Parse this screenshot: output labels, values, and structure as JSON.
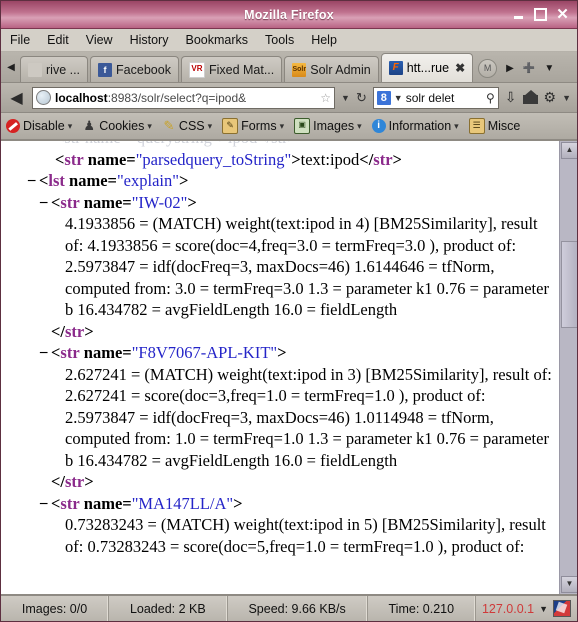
{
  "window": {
    "title": "Mozilla Firefox",
    "buttons": {
      "minimize": "_",
      "maximize": "□",
      "close": "✕"
    }
  },
  "menubar": [
    {
      "label": "File"
    },
    {
      "label": "Edit"
    },
    {
      "label": "View"
    },
    {
      "label": "History"
    },
    {
      "label": "Bookmarks"
    },
    {
      "label": "Tools"
    },
    {
      "label": "Help"
    }
  ],
  "tabbar": {
    "scroll_left": "◀",
    "scroll_right": "▶",
    "new_tab": "➕",
    "list_all": "▼",
    "tabs": [
      {
        "label": "rive ...",
        "favicon": "none-icon",
        "favicon_text": ""
      },
      {
        "label": "Facebook",
        "favicon": "facebook-icon",
        "favicon_text": "f"
      },
      {
        "label": "Fixed Mat...",
        "favicon": "vr-icon",
        "favicon_text": "VR"
      },
      {
        "label": "Solr Admin",
        "favicon": "solr-icon",
        "favicon_text": "Solr"
      },
      {
        "label": "htt...rue",
        "favicon": "firefox-icon",
        "favicon_text": "F",
        "active": true,
        "close": "✖"
      }
    ],
    "mail_button": "M"
  },
  "navbar": {
    "back_icon": "◀",
    "url_host": "localhost",
    "url_rest": ":8983/solr/select?q=ipod&",
    "star_icon": "☆",
    "dropdown_icon": "▼",
    "reload_icon": "↺",
    "search_engine": "8",
    "search_value": "solr delet",
    "search_icon": "⚲",
    "download_icon": "⇩",
    "home_icon": "home-icon",
    "extra_icon": "▼"
  },
  "devbar": [
    {
      "label": "Disable",
      "icon": "disable-icon",
      "caret": "▾"
    },
    {
      "label": "Cookies",
      "icon": "cookies-icon",
      "caret": "▾"
    },
    {
      "label": "CSS",
      "icon": "css-icon",
      "caret": "▾"
    },
    {
      "label": "Forms",
      "icon": "forms-icon",
      "caret": "▾"
    },
    {
      "label": "Images",
      "icon": "images-icon",
      "caret": "▾"
    },
    {
      "label": "Information",
      "icon": "information-icon",
      "caret": "▾"
    },
    {
      "label": "Misce",
      "icon": "misc-icon",
      "caret": ""
    }
  ],
  "content": {
    "ghost_line": "<str name=\"querystring\">ipod</str>",
    "lines": [
      {
        "indent": 1,
        "twisty": "",
        "parts": [
          {
            "t": "angle",
            "v": "<"
          },
          {
            "t": "tag",
            "v": "str"
          },
          {
            "t": "sp",
            "v": " "
          },
          {
            "t": "attr",
            "v": "name"
          },
          {
            "t": "angle",
            "v": "="
          },
          {
            "t": "attrval",
            "v": "\"parsedquery_toString\""
          },
          {
            "t": "angle",
            "v": ">"
          },
          {
            "t": "plain",
            "v": "text:ipod"
          },
          {
            "t": "angle",
            "v": "</"
          },
          {
            "t": "tag",
            "v": "str"
          },
          {
            "t": "angle",
            "v": ">"
          }
        ]
      },
      {
        "indent": 2,
        "twisty": "−",
        "parts": [
          {
            "t": "angle",
            "v": "<"
          },
          {
            "t": "tag",
            "v": "lst"
          },
          {
            "t": "sp",
            "v": " "
          },
          {
            "t": "attr",
            "v": "name"
          },
          {
            "t": "angle",
            "v": "="
          },
          {
            "t": "attrval",
            "v": "\"explain\""
          },
          {
            "t": "angle",
            "v": ">"
          }
        ]
      },
      {
        "indent": 3,
        "twisty": "−",
        "parts": [
          {
            "t": "angle",
            "v": "<"
          },
          {
            "t": "tag",
            "v": "str"
          },
          {
            "t": "sp",
            "v": " "
          },
          {
            "t": "attr",
            "v": "name"
          },
          {
            "t": "angle",
            "v": "="
          },
          {
            "t": "attrval",
            "v": "\"IW-02\""
          },
          {
            "t": "angle",
            "v": ">"
          }
        ]
      },
      {
        "indent": 4,
        "twisty": "",
        "wrap": true,
        "parts": [
          {
            "t": "plain",
            "v": "4.1933856 = (MATCH) weight(text:ipod in 4) [BM25Similarity], result of: 4.1933856 = score(doc=4,freq=3.0 = termFreq=3.0 ), product of: 2.5973847 = idf(docFreq=3, maxDocs=46) 1.6144646 = tfNorm, computed from: 3.0 = termFreq=3.0 1.3 = parameter k1 0.76 = parameter b 16.434782 = avgFieldLength 16.0 = fieldLength"
          }
        ]
      },
      {
        "indent": 3,
        "twisty": "",
        "parts": [
          {
            "t": "angle",
            "v": "</"
          },
          {
            "t": "tag",
            "v": "str"
          },
          {
            "t": "angle",
            "v": ">"
          }
        ]
      },
      {
        "indent": 3,
        "twisty": "−",
        "parts": [
          {
            "t": "angle",
            "v": "<"
          },
          {
            "t": "tag",
            "v": "str"
          },
          {
            "t": "sp",
            "v": " "
          },
          {
            "t": "attr",
            "v": "name"
          },
          {
            "t": "angle",
            "v": "="
          },
          {
            "t": "attrval",
            "v": "\"F8V7067-APL-KIT\""
          },
          {
            "t": "angle",
            "v": ">"
          }
        ]
      },
      {
        "indent": 4,
        "twisty": "",
        "wrap": true,
        "parts": [
          {
            "t": "plain",
            "v": "2.627241 = (MATCH) weight(text:ipod in 3) [BM25Similarity], result of: 2.627241 = score(doc=3,freq=1.0 = termFreq=1.0 ), product of: 2.5973847 = idf(docFreq=3, maxDocs=46) 1.0114948 = tfNorm, computed from: 1.0 = termFreq=1.0 1.3 = parameter k1 0.76 = parameter b 16.434782 = avgFieldLength 16.0 = fieldLength"
          }
        ]
      },
      {
        "indent": 3,
        "twisty": "",
        "parts": [
          {
            "t": "angle",
            "v": "</"
          },
          {
            "t": "tag",
            "v": "str"
          },
          {
            "t": "angle",
            "v": ">"
          }
        ]
      },
      {
        "indent": 3,
        "twisty": "−",
        "parts": [
          {
            "t": "angle",
            "v": "<"
          },
          {
            "t": "tag",
            "v": "str"
          },
          {
            "t": "sp",
            "v": " "
          },
          {
            "t": "attr",
            "v": "name"
          },
          {
            "t": "angle",
            "v": "="
          },
          {
            "t": "attrval",
            "v": "\"MA147LL/A\""
          },
          {
            "t": "angle",
            "v": ">"
          }
        ]
      },
      {
        "indent": 4,
        "twisty": "",
        "wrap": true,
        "parts": [
          {
            "t": "plain",
            "v": "0.73283243 = (MATCH) weight(text:ipod in 5) [BM25Similarity], result of: 0.73283243 = score(doc=5,freq=1.0 = termFreq=1.0 ), product of:"
          }
        ]
      }
    ]
  },
  "scrollbar": {
    "up_icon": "▲",
    "down_icon": "▼"
  },
  "statusbar": {
    "images": "Images: 0/0",
    "loaded": "Loaded: 2 KB",
    "speed": "Speed: 9.66 KB/s",
    "time": "Time: 0.210",
    "ip": "127.0.0.1",
    "ip_caret": "▼"
  },
  "colors": {
    "titlebar": "#b86384",
    "chrome": "#b9b5ad",
    "tag": "#8b2a8b",
    "attrval": "#2424c8",
    "status_ip": "#cf3a3a"
  }
}
